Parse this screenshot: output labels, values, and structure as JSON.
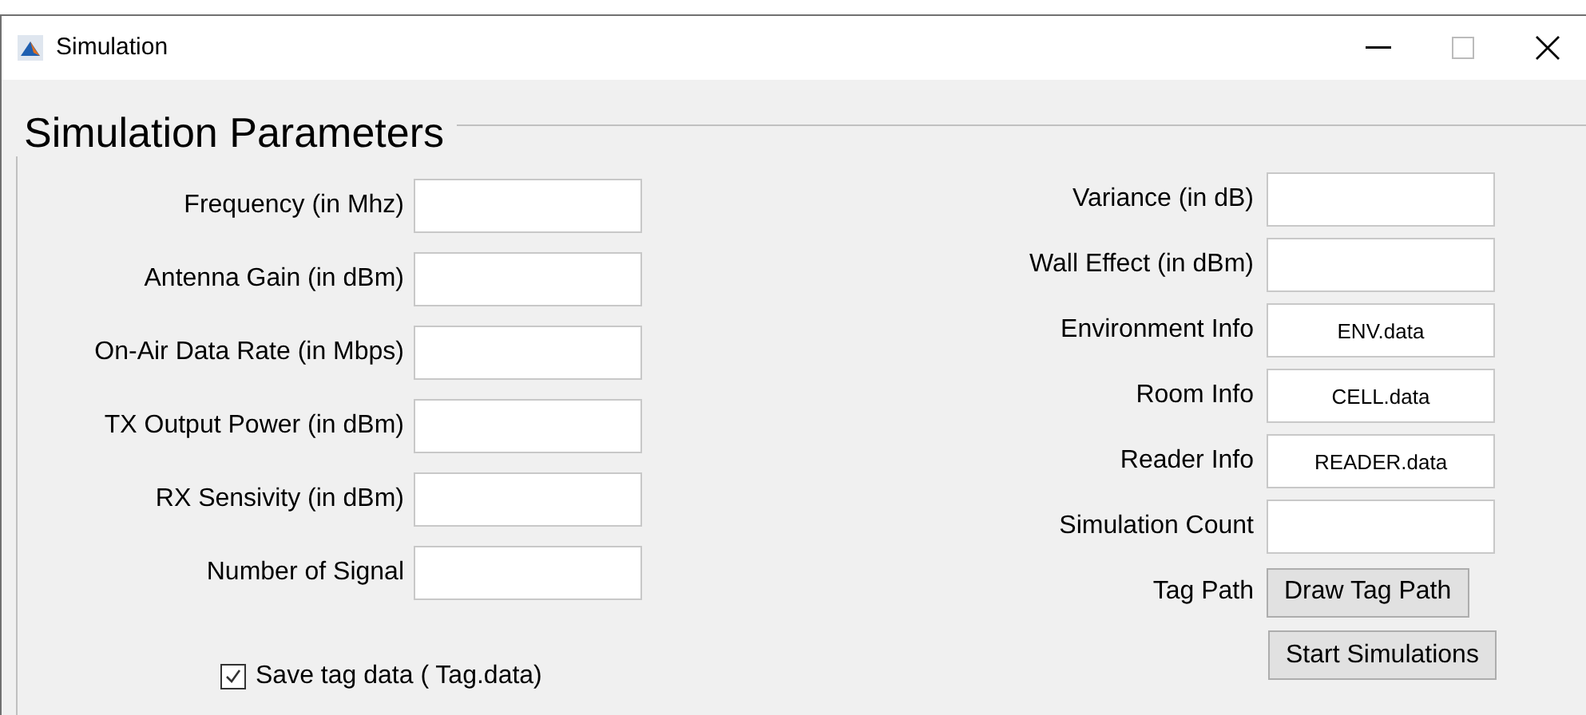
{
  "window": {
    "title": "Simulation"
  },
  "panel": {
    "title": "Simulation Parameters"
  },
  "left_fields": [
    {
      "label": "Frequency (in Mhz)"
    },
    {
      "label": "Antenna Gain (in dBm)"
    },
    {
      "label": "On-Air Data Rate (in Mbps)"
    },
    {
      "label": "TX Output Power (in dBm)"
    },
    {
      "label": "RX Sensivity (in dBm)"
    },
    {
      "label": "Number of Signal"
    }
  ],
  "save_checkbox": {
    "label": "Save tag data ( Tag.data)",
    "checked": true
  },
  "right_fields": [
    {
      "kind": "field",
      "label": "Variance (in dB)"
    },
    {
      "kind": "field",
      "label": "Wall Effect (in dBm)"
    },
    {
      "kind": "field",
      "label": "Environment Info",
      "value": "ENV.data"
    },
    {
      "kind": "field",
      "label": "Room Info",
      "value": "CELL.data"
    },
    {
      "kind": "field",
      "label": "Reader Info",
      "value": "READER.data"
    },
    {
      "kind": "field",
      "label": "Simulation Count"
    },
    {
      "kind": "button",
      "label": "Tag Path",
      "button": "Draw Tag Path"
    }
  ],
  "start_button": "Start Simulations"
}
